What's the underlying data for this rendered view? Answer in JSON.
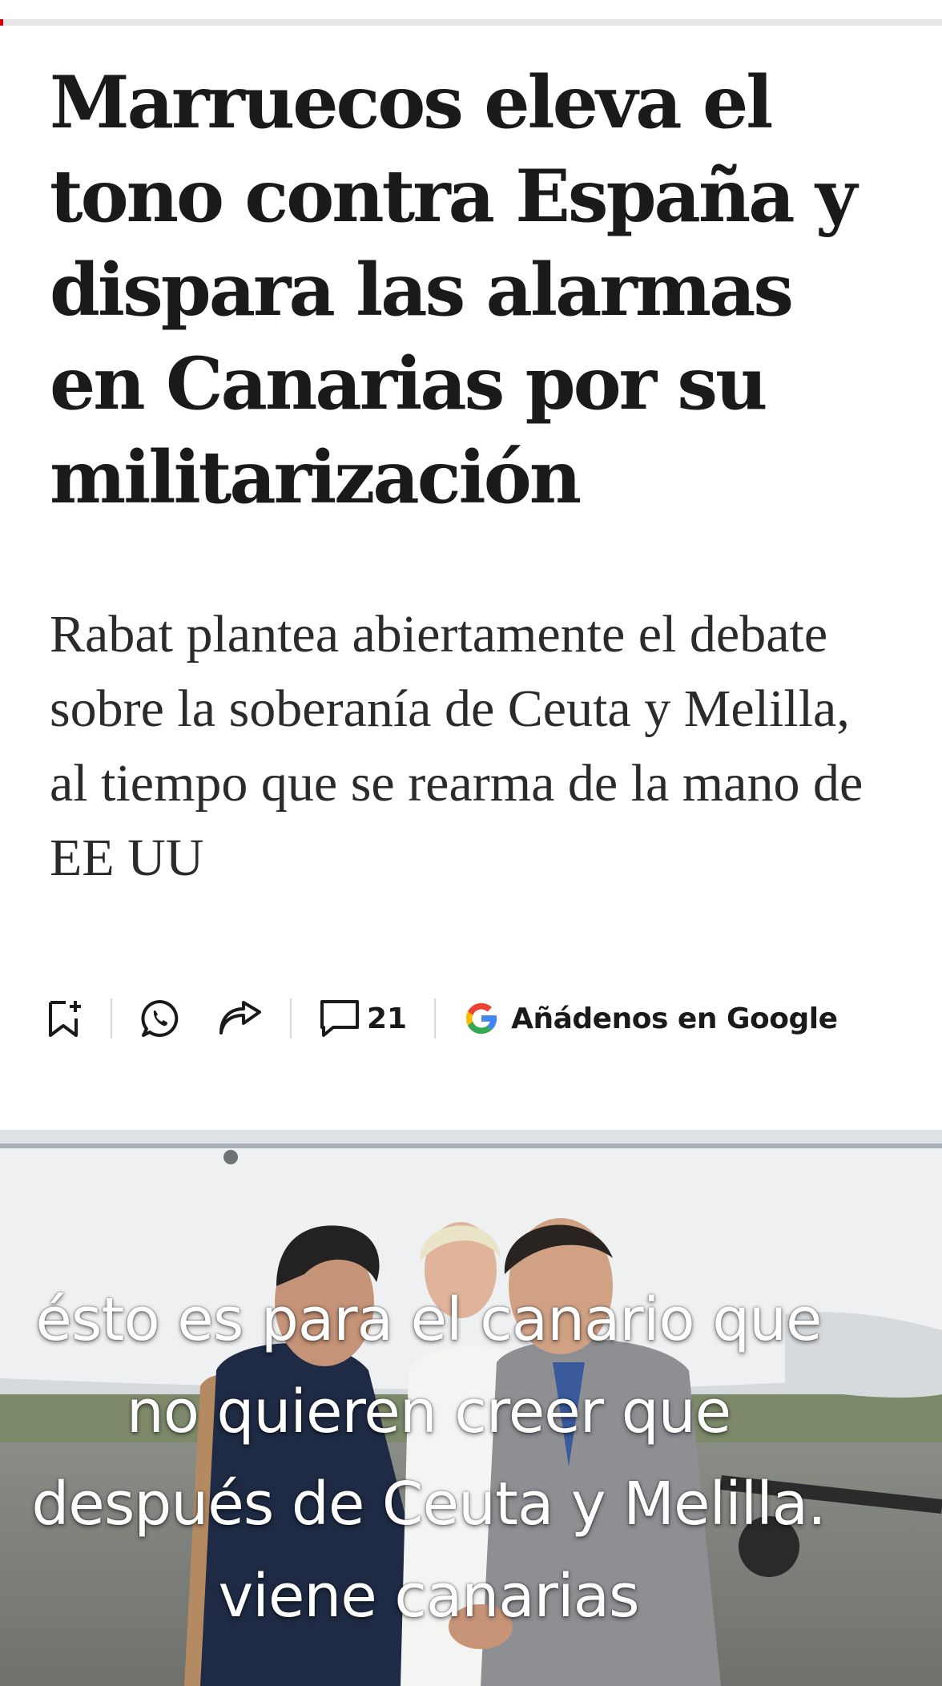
{
  "progress": {
    "fraction": 0.003
  },
  "article": {
    "headline": "Marruecos eleva el tono contra España y dispara las alarmas en Canarias por su militarización",
    "subtitle": "Rabat plantea abiertamente el debate sobre la soberanía de Ceuta y Melilla, al tiempo que se rearma de la mano de EE UU"
  },
  "actions": {
    "bookmark_icon": "bookmark-add-icon",
    "whatsapp_icon": "whatsapp-icon",
    "share_icon": "share-arrow-icon",
    "comment_icon": "comment-icon",
    "comments_count": "21",
    "google_icon": "google-g-icon",
    "google_label": "Añádenos en Google"
  },
  "video_caption": {
    "lines": [
      "ésto es para el canario que",
      "no quieren creer que",
      "después de Ceuta y Melilla.",
      "viene canarias"
    ]
  },
  "colors": {
    "accent": "#cc0000",
    "text": "#1a1a1a",
    "google_blue": "#4285F4",
    "google_red": "#EA4335",
    "google_yellow": "#FBBC05",
    "google_green": "#34A853"
  }
}
